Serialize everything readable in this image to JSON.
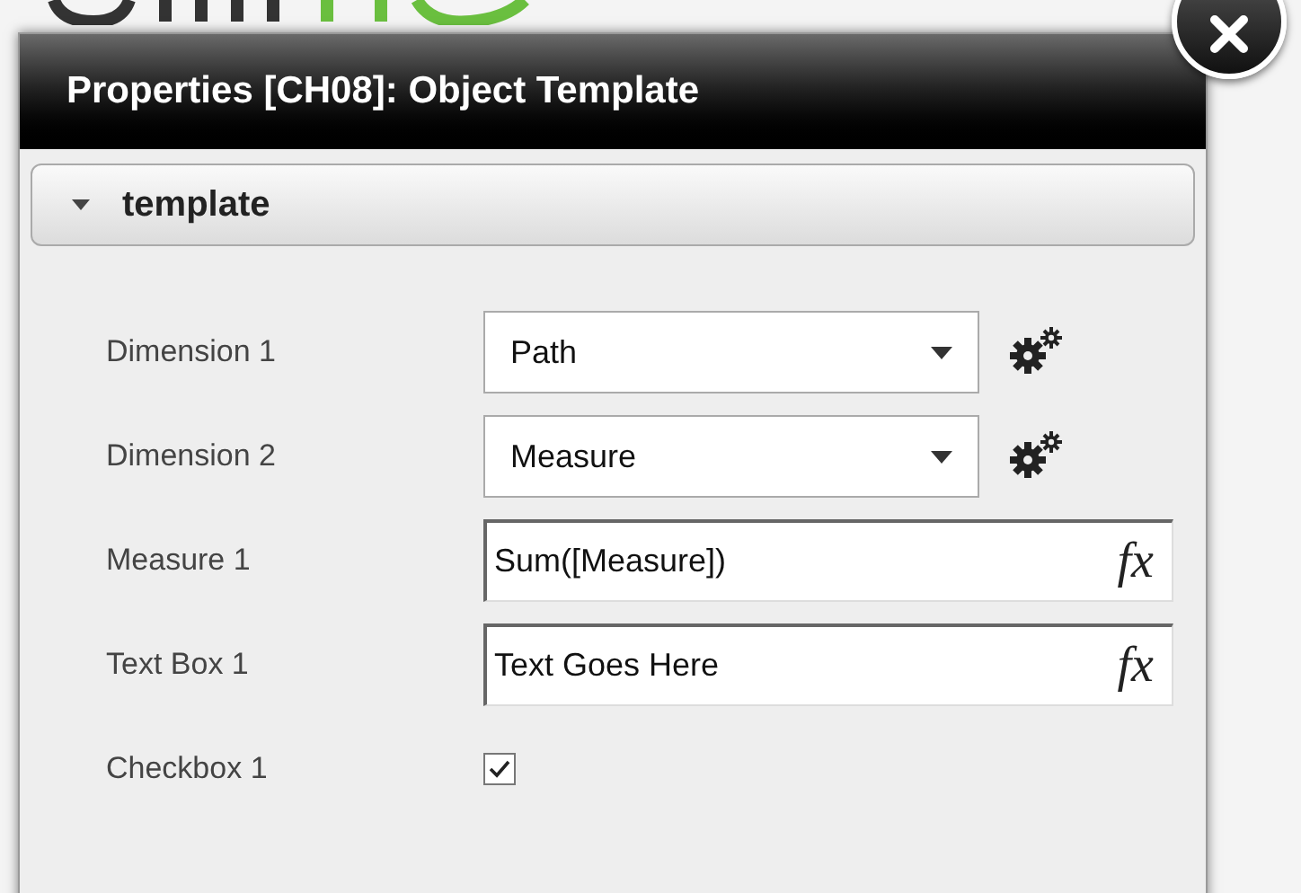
{
  "window": {
    "title": "Properties [CH08]: Object Template"
  },
  "section": {
    "title": "template",
    "expanded": true
  },
  "rows": [
    {
      "kind": "dropdown",
      "label": "Dimension 1",
      "value": "Path"
    },
    {
      "kind": "dropdown",
      "label": "Dimension 2",
      "value": "Measure"
    },
    {
      "kind": "expression",
      "label": "Measure 1",
      "value": "Sum([Measure])",
      "button": "fx"
    },
    {
      "kind": "expression",
      "label": "Text Box 1",
      "value": "Text Goes Here",
      "button": "fx"
    },
    {
      "kind": "checkbox",
      "label": "Checkbox 1",
      "checked": true
    }
  ]
}
